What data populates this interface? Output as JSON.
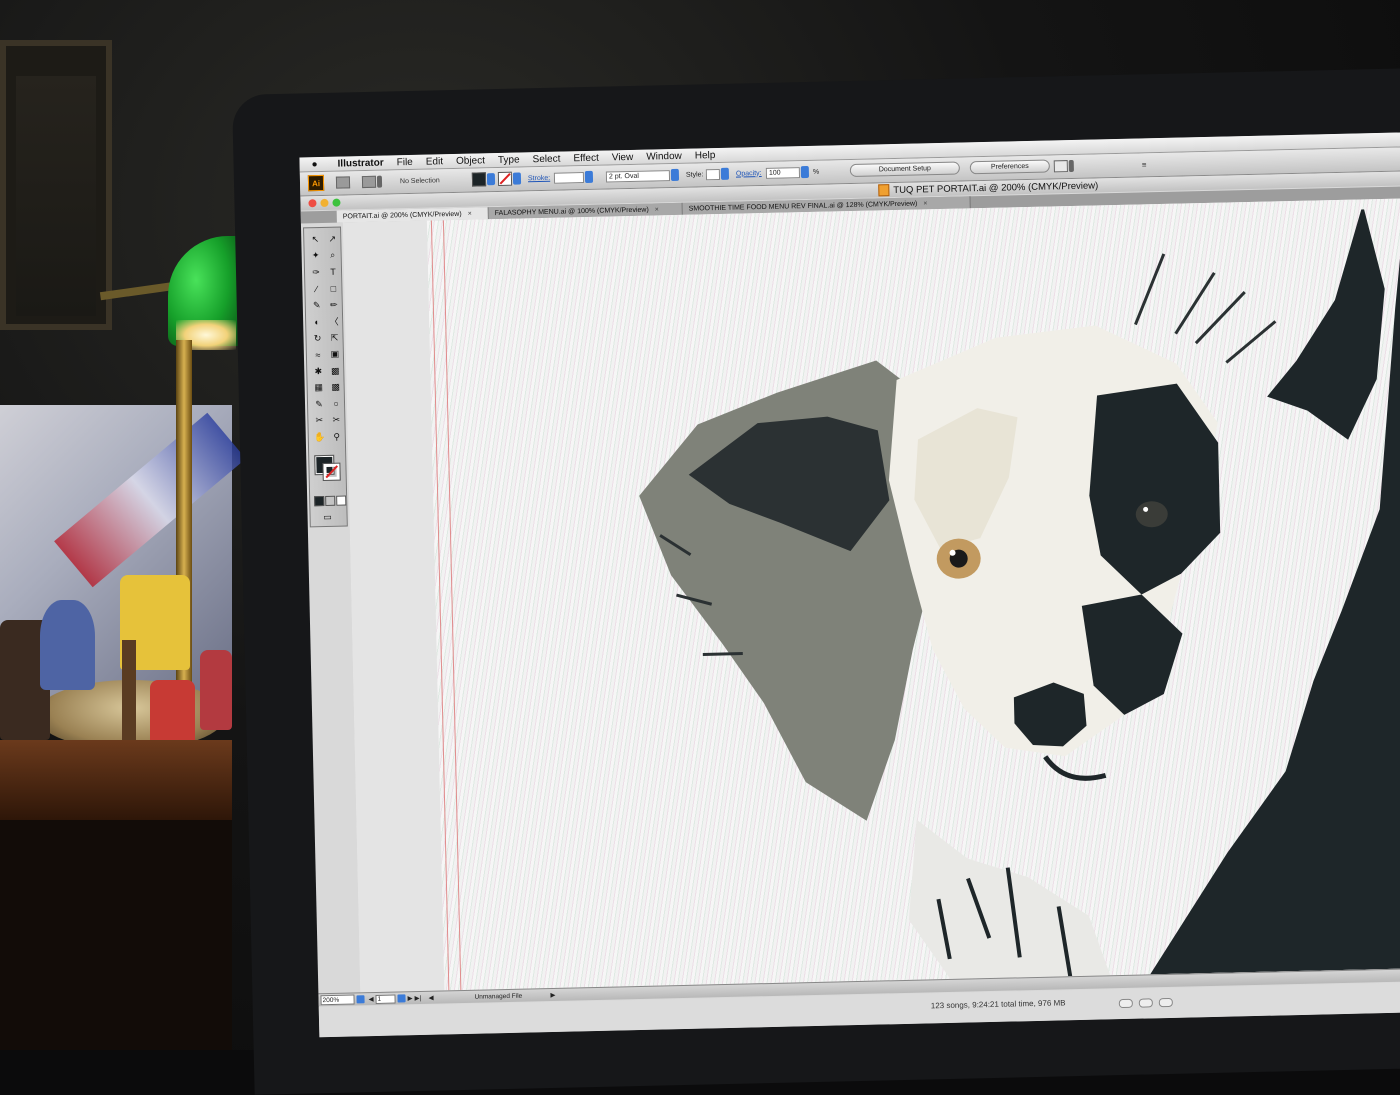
{
  "menubar": {
    "app": "Illustrator",
    "items": [
      "File",
      "Edit",
      "Object",
      "Type",
      "Select",
      "Effect",
      "View",
      "Window",
      "Help"
    ]
  },
  "controlbar": {
    "ai_logo": "Ai",
    "selection": "No Selection",
    "stroke_label": "Stroke:",
    "brush": "2 pt. Oval",
    "style_label": "Style:",
    "opacity_label": "Opacity:",
    "opacity_value": "100",
    "opacity_unit": "%",
    "document_setup": "Document Setup",
    "preferences": "Preferences"
  },
  "document": {
    "title": "TUQ PET PORTAIT.ai @ 200% (CMYK/Preview)"
  },
  "tabs": [
    {
      "label": "PORTAIT.ai @ 200% (CMYK/Preview)",
      "active": true
    },
    {
      "label": "FALASOPHY MENU.ai @ 100% (CMYK/Preview)",
      "active": false
    },
    {
      "label": "SMOOTHIE TIME FOOD MENU REV FINAL.ai @ 128% (CMYK/Preview)",
      "active": false
    }
  ],
  "tools": [
    "selection-tool",
    "direct-selection-tool",
    "magic-wand-tool",
    "lasso-tool",
    "pen-tool",
    "type-tool",
    "line-tool",
    "rectangle-tool",
    "paintbrush-tool",
    "pencil-tool",
    "blob-brush-tool",
    "eraser-tool",
    "rotate-tool",
    "scale-tool",
    "warp-tool",
    "free-transform-tool",
    "symbol-sprayer-tool",
    "column-graph-tool",
    "mesh-tool",
    "gradient-tool",
    "eyedropper-tool",
    "blend-tool",
    "slice-tool",
    "scissors-tool",
    "hand-tool",
    "zoom-tool"
  ],
  "tool_glyphs": {
    "type": "T"
  },
  "statusbar": {
    "zoom": "200%",
    "page": "1",
    "file_status": "Unmanaged File"
  },
  "itunes": {
    "summary": "123 songs, 9:24:21 total time, 976 MB"
  },
  "colors": {
    "fill": "#1c2427",
    "accent": "#3b7bd8",
    "dog_dark": "#1e2629",
    "dog_grey": "#7f8279",
    "dog_light": "#e8e4d6"
  }
}
